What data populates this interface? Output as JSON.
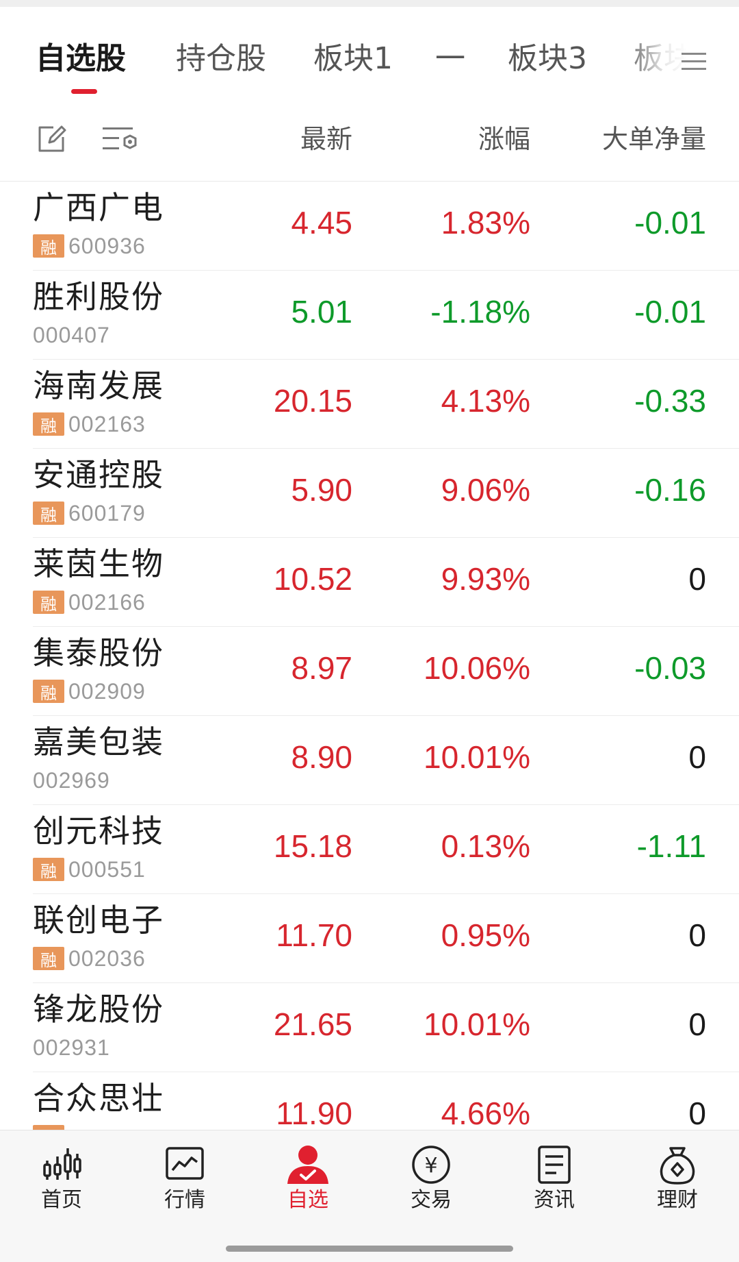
{
  "tabs": [
    "自选股",
    "持仓股",
    "板块1",
    "一",
    "板块3",
    "板块"
  ],
  "header": {
    "latest": "最新",
    "change_pct": "涨幅",
    "big_order_net": "大单净量"
  },
  "colors": {
    "up": "#d7262e",
    "down": "#0e9a2a",
    "flat": "#1a1a1a",
    "accent": "#e0202f",
    "margin_badge": "#e8965a"
  },
  "margin_badge_label": "融",
  "stocks": [
    {
      "name": "广西广电",
      "code": "600936",
      "margin": true,
      "price": "4.45",
      "price_color": "up",
      "pct": "1.83%",
      "pct_color": "up",
      "net": "-0.01",
      "net_color": "down"
    },
    {
      "name": "胜利股份",
      "code": "000407",
      "margin": false,
      "price": "5.01",
      "price_color": "down",
      "pct": "-1.18%",
      "pct_color": "down",
      "net": "-0.01",
      "net_color": "down"
    },
    {
      "name": "海南发展",
      "code": "002163",
      "margin": true,
      "price": "20.15",
      "price_color": "up",
      "pct": "4.13%",
      "pct_color": "up",
      "net": "-0.33",
      "net_color": "down"
    },
    {
      "name": "安通控股",
      "code": "600179",
      "margin": true,
      "price": "5.90",
      "price_color": "up",
      "pct": "9.06%",
      "pct_color": "up",
      "net": "-0.16",
      "net_color": "down"
    },
    {
      "name": "莱茵生物",
      "code": "002166",
      "margin": true,
      "price": "10.52",
      "price_color": "up",
      "pct": "9.93%",
      "pct_color": "up",
      "net": "0",
      "net_color": "flat"
    },
    {
      "name": "集泰股份",
      "code": "002909",
      "margin": true,
      "price": "8.97",
      "price_color": "up",
      "pct": "10.06%",
      "pct_color": "up",
      "net": "-0.03",
      "net_color": "down"
    },
    {
      "name": "嘉美包装",
      "code": "002969",
      "margin": false,
      "price": "8.90",
      "price_color": "up",
      "pct": "10.01%",
      "pct_color": "up",
      "net": "0",
      "net_color": "flat"
    },
    {
      "name": "创元科技",
      "code": "000551",
      "margin": true,
      "price": "15.18",
      "price_color": "up",
      "pct": "0.13%",
      "pct_color": "up",
      "net": "-1.11",
      "net_color": "down"
    },
    {
      "name": "联创电子",
      "code": "002036",
      "margin": true,
      "price": "11.70",
      "price_color": "up",
      "pct": "0.95%",
      "pct_color": "up",
      "net": "0",
      "net_color": "flat"
    },
    {
      "name": "锋龙股份",
      "code": "002931",
      "margin": false,
      "price": "21.65",
      "price_color": "up",
      "pct": "10.01%",
      "pct_color": "up",
      "net": "0",
      "net_color": "flat"
    },
    {
      "name": "合众思壮",
      "code": "",
      "margin": true,
      "price": "11.90",
      "price_color": "up",
      "pct": "4.66%",
      "pct_color": "up",
      "net": "0",
      "net_color": "flat"
    }
  ],
  "nav": [
    {
      "label": "首页",
      "icon": "home-candlestick-icon"
    },
    {
      "label": "行情",
      "icon": "market-chart-icon"
    },
    {
      "label": "自选",
      "icon": "watchlist-person-icon"
    },
    {
      "label": "交易",
      "icon": "yuan-coin-icon"
    },
    {
      "label": "资讯",
      "icon": "news-document-icon"
    },
    {
      "label": "理财",
      "icon": "money-bag-icon"
    }
  ]
}
